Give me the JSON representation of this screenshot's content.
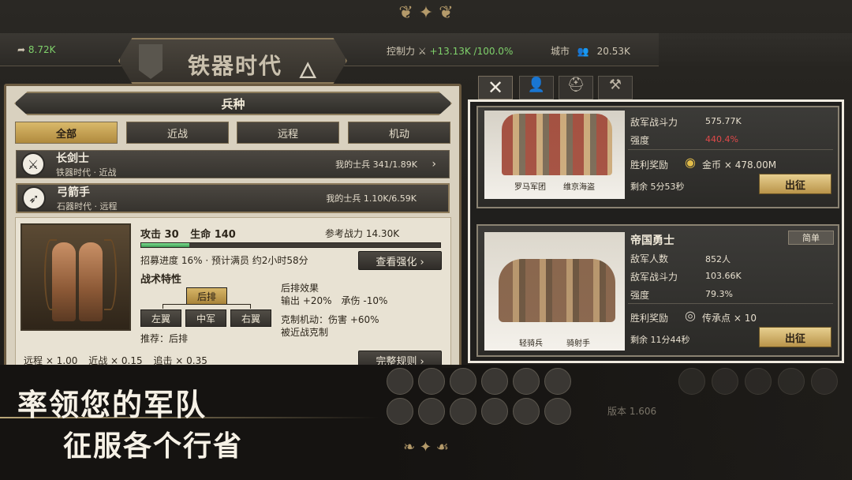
{
  "topbar": {
    "resource_value": "8.72K",
    "control_label": "控制力",
    "control_value": "+13.13K",
    "control_percent": "/100.0%",
    "city_label": "城市",
    "city_value": "20.53K",
    "era_title": "铁器时代"
  },
  "panel": {
    "title": "兵种",
    "tabs": [
      "全部",
      "近战",
      "远程",
      "机动"
    ]
  },
  "units": [
    {
      "name": "长剑士",
      "era": "铁器时代",
      "type": "近战",
      "soldiers": "我的士兵 341/1.89K"
    },
    {
      "name": "弓箭手",
      "era": "石器时代",
      "type": "远程",
      "soldiers": "我的士兵 1.10K/6.59K"
    }
  ],
  "detail": {
    "attack_label": "攻击",
    "attack": "30",
    "hp_label": "生命",
    "hp": "140",
    "power_label": "参考战力",
    "power": "14.30K",
    "recruit_progress": 0.16,
    "recruit_text": "招募进度 16%",
    "eta_text": "预计满员 约2小时58分",
    "view_upgrade": "查看强化 ›",
    "tactics_title": "战术特性",
    "positions": [
      "后排",
      "左翼",
      "中军",
      "右翼"
    ],
    "recommend": "推荐：后排",
    "effect_title": "后排效果",
    "effect_output": "输出 +20%",
    "effect_damage": "承伤 -10%",
    "counter_line1": "克制机动：伤害 +60%",
    "counter_line2": "被近战克制",
    "rules_button": "完整规则 ›",
    "mod_ranged": "远程 × 1.00",
    "mod_melee": "近战 × 0.15",
    "mod_pursuit": "追击 × 0.35"
  },
  "battles": [
    {
      "captions": [
        "罗马军团",
        "维京海盗"
      ],
      "power_label": "敌军战斗力",
      "power": "575.77K",
      "strength_label": "强度",
      "strength": "440.4%",
      "reward_label": "胜利奖励",
      "reward_name": "金币",
      "reward_amount": "× 478.00M",
      "remaining": "剩余 5分53秒",
      "sortie": "出征"
    },
    {
      "title": "帝国勇士",
      "difficulty": "简单",
      "count_label": "敌军人数",
      "count": "852人",
      "power_label": "敌军战斗力",
      "power": "103.66K",
      "strength_label": "强度",
      "strength": "79.3%",
      "reward_label": "胜利奖励",
      "reward_name": "传承点",
      "reward_amount": "× 10",
      "captions": [
        "轻骑兵",
        "骑射手"
      ],
      "remaining": "剩余 11分44秒",
      "sortie": "出征"
    }
  ],
  "promo": {
    "line1": "率领您的军队",
    "line2": "征服各个行省"
  },
  "version": "版本 1.606",
  "colors": {
    "gold": "#c9a24f",
    "strength_red": "#e0494a",
    "strength_green": "#7fd16b",
    "progress": "#4fb866"
  }
}
